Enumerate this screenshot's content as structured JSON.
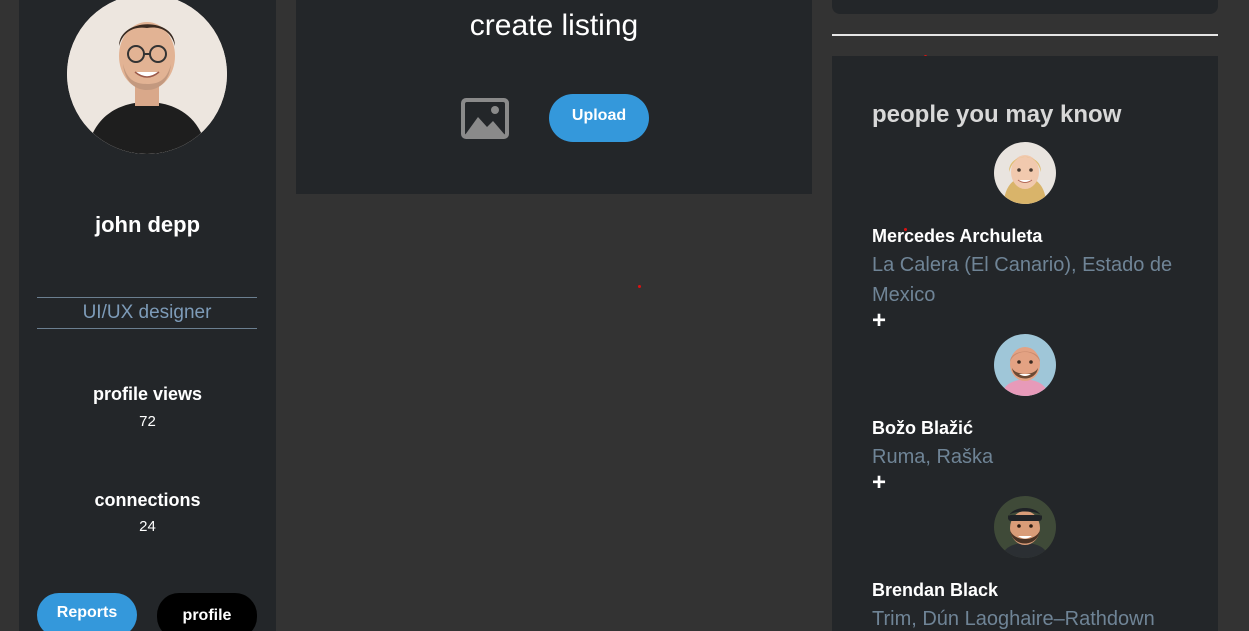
{
  "profile": {
    "name": "john depp",
    "role": "UI/UX designer",
    "stats": [
      {
        "label": "profile views",
        "value": "72"
      },
      {
        "label": "connections",
        "value": "24"
      }
    ],
    "buttons": {
      "reports": "Reports",
      "profile": "profile"
    },
    "avatar_icon": "user-photo"
  },
  "create_listing": {
    "title": "create listing",
    "image_icon": "image-icon",
    "upload_label": "Upload"
  },
  "people": {
    "title": "people you may know",
    "add_label": "+",
    "list": [
      {
        "name": "Mercedes Archuleta",
        "location": "La Calera (El Canario), Estado de Mexico"
      },
      {
        "name": "Božo Blažić",
        "location": "Ruma, Raška"
      },
      {
        "name": "Brendan Black",
        "location": "Trim, Dún Laoghaire–Rathdown"
      }
    ]
  },
  "colors": {
    "page_bg": "#333333",
    "card_bg": "#232629",
    "accent": "#3498db",
    "muted_text": "#6f8496"
  }
}
